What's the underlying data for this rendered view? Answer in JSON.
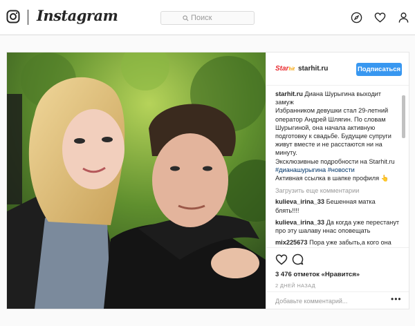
{
  "app": {
    "name": "Instagram"
  },
  "search": {
    "placeholder": "Поиск"
  },
  "post": {
    "author": "starhit.ru",
    "avatar_text": "Star",
    "avatar_sub": "hit",
    "follow_label": "Подписаться",
    "caption": {
      "author": "starhit.ru",
      "line1": "Диана Шурыгина выходит замуж",
      "line2": "Избранником девушки стал 29-летний оператор Андрей Шлягин. По словам Шурыгиной, она начала активную подготовку к свадьбе. Будущие супруги живут вместе и не расстаются ни на минуту.",
      "line3": "Эксклюзивные подробности на Starhit.ru",
      "tags": "#дианашурыгина #новости",
      "line4": "Активная ссылка в шапке профиля 👆"
    },
    "load_more": "Загрузить еще комментарии",
    "comments": [
      {
        "user": "kulieva_irina_33",
        "text": "Бешенная матка блять!!!!"
      },
      {
        "user": "kulieva_irina_33",
        "text": "Да когда уже перестанут про эту шалаву ннас оповещать"
      },
      {
        "user": "mix225673",
        "text": "Пора уже забыть,а кого она только уже замуж не собралась,лишь бы говорили о ней)"
      }
    ],
    "likes": "3 476 отметок «Нравится»",
    "time": "2 дней назад",
    "add_comment_placeholder": "Добавьте комментарий...",
    "more_label": "•••"
  },
  "colors": {
    "accent": "#3897f0",
    "border": "#dbdbdb",
    "text": "#262626",
    "muted": "#999999"
  }
}
